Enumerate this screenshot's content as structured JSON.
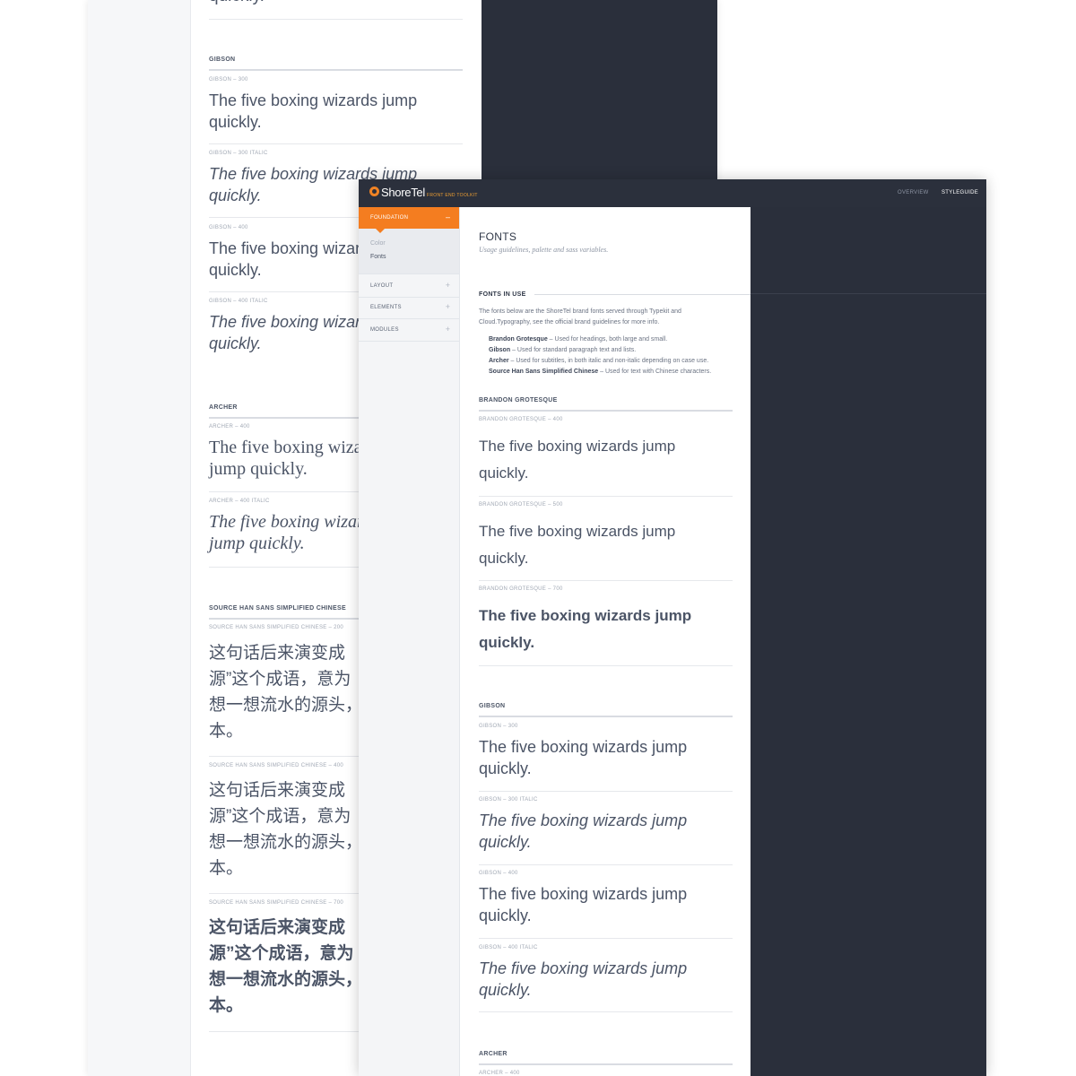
{
  "back_window": {
    "gibson": {
      "section_label": "GIBSON",
      "samples": [
        {
          "label": "GIBSON – 300",
          "text": "The five boxing wizards jump",
          "text2": "quickly."
        },
        {
          "label": "GIBSON – 300 ITALIC",
          "text": "The five boxing wizards jump",
          "text2": "quickly."
        },
        {
          "label": "GIBSON – 400",
          "text": "The five boxing wizards jump",
          "text2": "quickly."
        },
        {
          "label": "GIBSON – 400 ITALIC",
          "text": "The five boxing wizards jump",
          "text2": "quickly."
        }
      ]
    },
    "archer": {
      "section_label": "ARCHER",
      "samples": [
        {
          "label": "ARCHER – 400",
          "text": "The five boxing wizards",
          "text2": "jump quickly."
        },
        {
          "label": "ARCHER – 400 ITALIC",
          "text": "The five boxing wizards",
          "text2": "jump quickly."
        }
      ]
    },
    "source_han": {
      "section_label": "SOURCE HAN SANS SIMPLIFIED CHINESE",
      "samples": [
        {
          "label": "SOURCE HAN SANS SIMPLIFIED CHINESE – 200",
          "l1": "这句话后来演变成",
          "l2": "源”这个成语，意为",
          "l3": "想一想流水的源头，",
          "l4": "本。"
        },
        {
          "label": "SOURCE HAN SANS SIMPLIFIED CHINESE – 400",
          "l1": "这句话后来演变成",
          "l2": "源”这个成语，意为",
          "l3": "想一想流水的源头，",
          "l4": "本。"
        },
        {
          "label": "SOURCE HAN SANS SIMPLIFIED CHINESE – 700",
          "l1": "这句话后来演变成",
          "l2": "源”这个成语，意为",
          "l3": "想一想流水的源头，",
          "l4": "本。"
        }
      ]
    }
  },
  "front_window": {
    "topbar": {
      "logo": "ShoreTel",
      "logo_sub": "FRONT END TOOLKIT",
      "nav": [
        "OVERVIEW",
        "STYLEGUIDE"
      ],
      "active_nav": "STYLEGUIDE"
    },
    "sidebar": {
      "active": {
        "label": "FOUNDATION",
        "symbol": "–"
      },
      "sub_items": [
        "Color",
        "Fonts"
      ],
      "items": [
        {
          "label": "LAYOUT",
          "symbol": "+"
        },
        {
          "label": "ELEMENTS",
          "symbol": "+"
        },
        {
          "label": "MODULES",
          "symbol": "+"
        }
      ]
    },
    "main": {
      "title": "FONTS",
      "subtitle": "Usage guidelines, palette and sass variables.",
      "section_label": "FONTS IN USE",
      "intro_line1": "The fonts below are the ShoreTel brand fonts served through Typekit and",
      "intro_line2": "Cloud.Typography, see the official brand guidelines for more info.",
      "font_list": [
        {
          "name": "Brandon Grotesque",
          "desc": " – Used for headings, both large and small."
        },
        {
          "name": "Gibson",
          "desc": " – Used for standard paragraph text and lists."
        },
        {
          "name": "Archer",
          "desc": " – Used for subtitles, in both italic and non-italic depending on case use."
        },
        {
          "name": "Source Han Sans Simplified Chinese",
          "desc": " – Used for text with Chinese characters."
        }
      ],
      "brandon": {
        "section_label": "BRANDON GROTESQUE",
        "samples": [
          {
            "label": "BRANDON GROTESQUE – 400",
            "text": "The five boxing wizards jump",
            "text2": "quickly."
          },
          {
            "label": "BRANDON GROTESQUE – 500",
            "text": "The five boxing wizards jump",
            "text2": "quickly."
          },
          {
            "label": "BRANDON GROTESQUE – 700",
            "text": "The five boxing wizards jump",
            "text2": "quickly."
          }
        ]
      },
      "gibson": {
        "section_label": "GIBSON",
        "samples": [
          {
            "label": "GIBSON – 300",
            "text": "The five boxing wizards jump",
            "text2": "quickly."
          },
          {
            "label": "GIBSON – 300 ITALIC",
            "text": "The five boxing wizards jump",
            "text2": "quickly."
          },
          {
            "label": "GIBSON – 400",
            "text": "The five boxing wizards jump",
            "text2": "quickly."
          },
          {
            "label": "GIBSON – 400 ITALIC",
            "text": "The five boxing wizards jump",
            "text2": "quickly."
          }
        ]
      },
      "archer": {
        "section_label": "ARCHER",
        "first_label": "ARCHER – 400"
      }
    }
  },
  "colors": {
    "accent": "#f47d20",
    "dark_panel": "#2a2f3b",
    "text": "#4b5466"
  }
}
